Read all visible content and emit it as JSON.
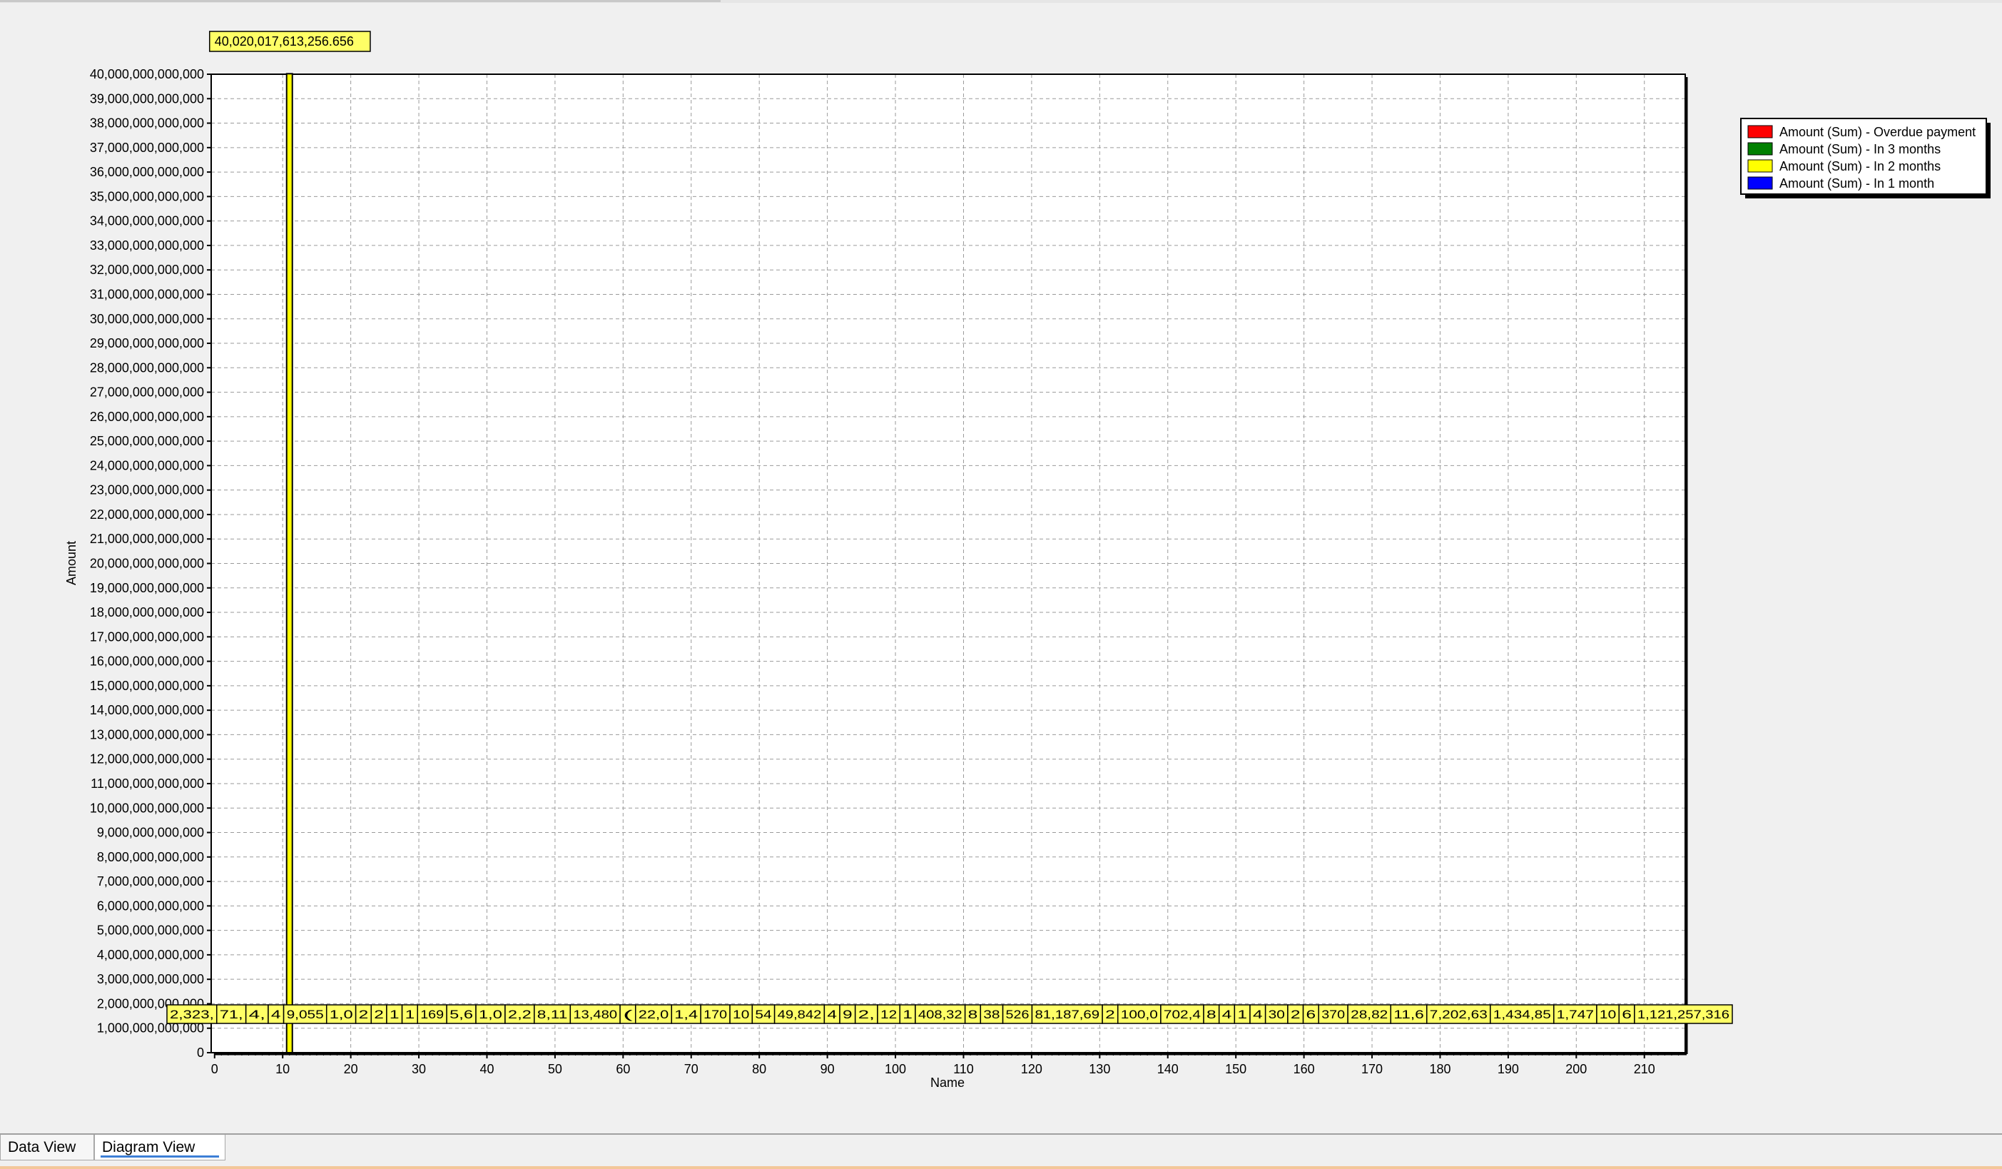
{
  "tabs": [
    {
      "label": "Data View",
      "active": false
    },
    {
      "label": "Diagram View",
      "active": true
    }
  ],
  "legend": [
    {
      "label": "Amount (Sum) - Overdue payment",
      "color": "#ff0000"
    },
    {
      "label": "Amount (Sum) - In 3 months",
      "color": "#008000"
    },
    {
      "label": "Amount (Sum) - In 2 months",
      "color": "#ffff00"
    },
    {
      "label": "Amount (Sum) - In 1 month",
      "color": "#0000ff"
    }
  ],
  "colors": {
    "bar": "#ffff00",
    "label_bg": "#ffff66",
    "grid": "#9a9a9a"
  },
  "chart_data": {
    "type": "bar",
    "xlabel": "Name",
    "ylabel": "Amount",
    "xlim": [
      -0.5,
      216
    ],
    "ylim": [
      0,
      40000000000000
    ],
    "x_ticks": [
      0,
      10,
      20,
      30,
      40,
      50,
      60,
      70,
      80,
      90,
      100,
      110,
      120,
      130,
      140,
      150,
      160,
      170,
      180,
      190,
      200,
      210
    ],
    "y_ticks": [
      "0",
      "1,000,000,000,000",
      "2,000,000,000,000",
      "3,000,000,000,000",
      "4,000,000,000,000",
      "5,000,000,000,000",
      "6,000,000,000,000",
      "7,000,000,000,000",
      "8,000,000,000,000",
      "9,000,000,000,000",
      "10,000,000,000,000",
      "11,000,000,000,000",
      "12,000,000,000,000",
      "13,000,000,000,000",
      "14,000,000,000,000",
      "15,000,000,000,000",
      "16,000,000,000,000",
      "17,000,000,000,000",
      "18,000,000,000,000",
      "19,000,000,000,000",
      "20,000,000,000,000",
      "21,000,000,000,000",
      "22,000,000,000,000",
      "23,000,000,000,000",
      "24,000,000,000,000",
      "25,000,000,000,000",
      "26,000,000,000,000",
      "27,000,000,000,000",
      "28,000,000,000,000",
      "29,000,000,000,000",
      "30,000,000,000,000",
      "31,000,000,000,000",
      "32,000,000,000,000",
      "33,000,000,000,000",
      "34,000,000,000,000",
      "35,000,000,000,000",
      "36,000,000,000,000",
      "37,000,000,000,000",
      "38,000,000,000,000",
      "39,000,000,000,000",
      "40,000,000,000,000"
    ],
    "grid": true,
    "legend_position": "right",
    "series": [
      {
        "name": "Amount (Sum) - In 2 months",
        "points": [
          {
            "x": 11,
            "y": 40020017613256.66,
            "label": "40,020,017,613,256.656"
          }
        ]
      }
    ],
    "data_labels": [
      "2,323,",
      "71,",
      "4,",
      "4",
      "9,055",
      "1,0",
      "2",
      "2",
      "1",
      "1",
      "169",
      "5,6",
      "1,0",
      "2,2",
      "8,11",
      "13,480",
      "(",
      "22,0",
      "1,4",
      "170",
      "10",
      "54",
      "49,842",
      "4",
      "9",
      "2,",
      "12",
      "1",
      "408,32",
      "8",
      "38",
      "526",
      "81,187,69",
      "2",
      "100,0",
      "702,4",
      "8",
      "4",
      "1",
      "4",
      "30",
      "2",
      "6",
      "370",
      "28,82",
      "11,6",
      "7,202,63",
      "1,434,85",
      "1,747",
      "10",
      "6",
      "1,121,257,316"
    ]
  }
}
